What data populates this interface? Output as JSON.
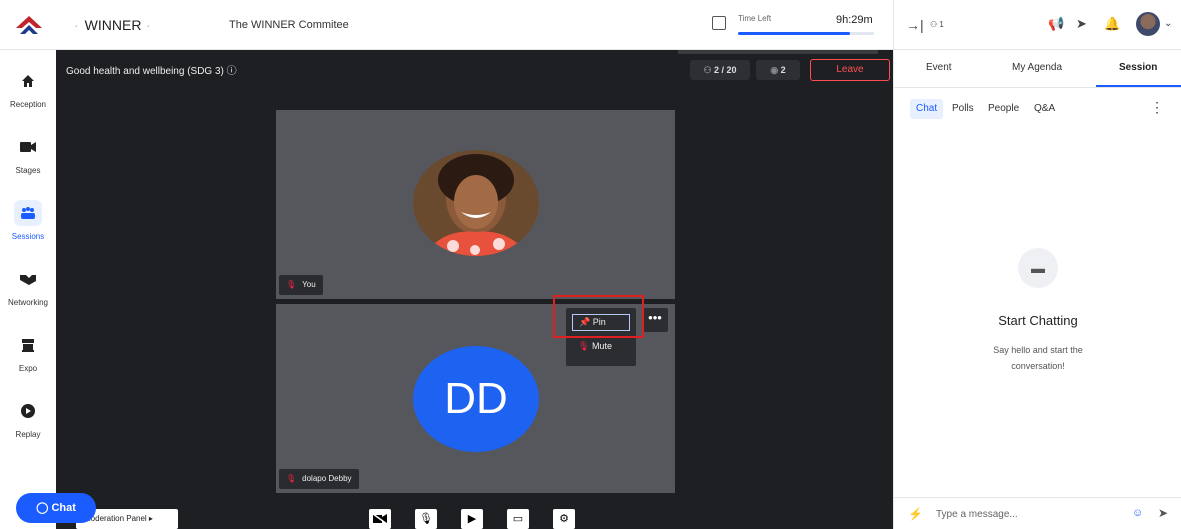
{
  "topbar": {
    "event_name": "WINNER",
    "organizer": "The WINNER Commitee",
    "time_left_label": "Time Left",
    "time_left_value": "9h:29m",
    "time_progress": 0.82
  },
  "sidebar": {
    "items": [
      {
        "label": "Reception",
        "icon": "home-icon"
      },
      {
        "label": "Stages",
        "icon": "video-camera-icon"
      },
      {
        "label": "Sessions",
        "icon": "people-group-icon"
      },
      {
        "label": "Networking",
        "icon": "handshake-icon"
      },
      {
        "label": "Expo",
        "icon": "booth-icon"
      },
      {
        "label": "Replay",
        "icon": "play-circle-icon"
      }
    ],
    "active": "Sessions"
  },
  "stage": {
    "session_title": "Good health and wellbeing (SDG 3) ⓘ",
    "on_stage_count": "2 / 20",
    "viewers_count": "2",
    "leave_label": "Leave",
    "tiles": [
      {
        "name": "You"
      },
      {
        "name": "dolapo Debby",
        "initials": "DD"
      }
    ],
    "menu": {
      "pin_label": "Pin",
      "mute_label": "Mute",
      "more": "•••"
    },
    "moderation_panel_label": "Moderation Panel ▸"
  },
  "chat_fab": {
    "label": "Chat"
  },
  "right_panel": {
    "people_count": "1",
    "tabs": [
      "Event",
      "My Agenda",
      "Session"
    ],
    "active_tab": "Session",
    "subtabs": [
      "Chat",
      "Polls",
      "People",
      "Q&A"
    ],
    "active_subtab": "Chat",
    "empty_title": "Start Chatting",
    "empty_sub": "Say hello and start the conversation!",
    "message_placeholder": "Type a message..."
  },
  "colors": {
    "accent": "#1a5cff",
    "stage_bg": "#1e1f23",
    "leave": "#ff5252",
    "highlight": "#e02020"
  }
}
